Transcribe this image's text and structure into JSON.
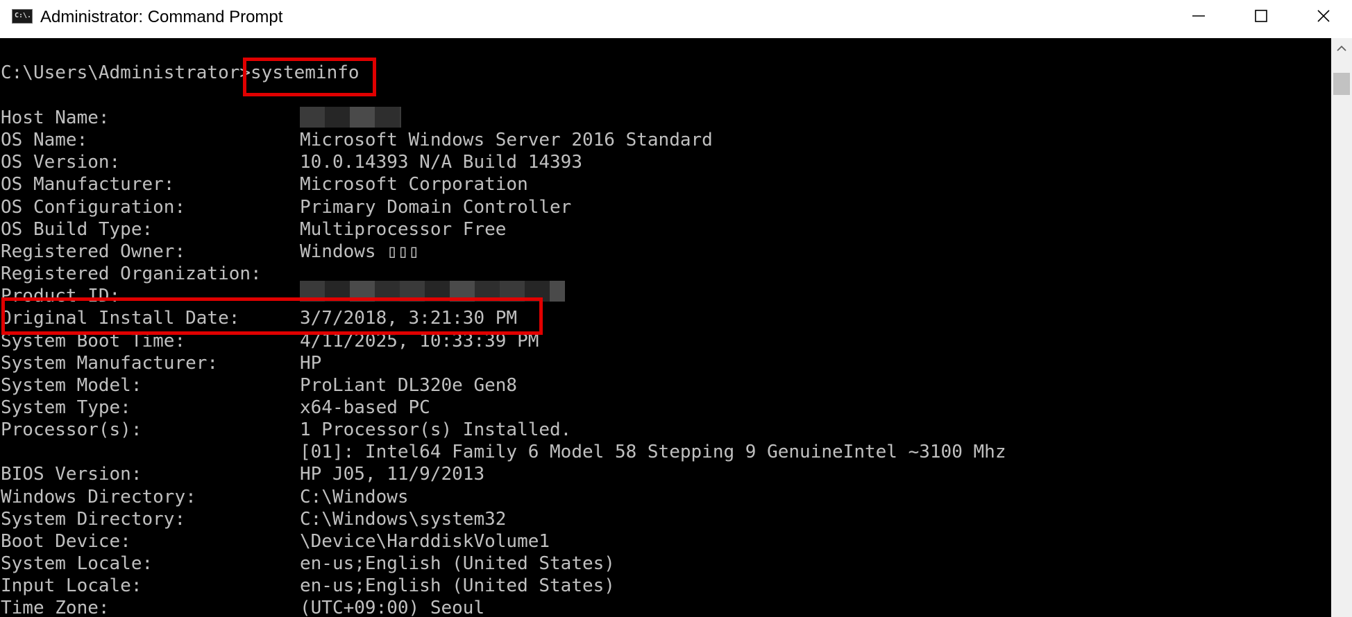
{
  "window": {
    "title": "Administrator: Command Prompt",
    "icon_label": "C:\\.",
    "icon_name": "cmd-console-icon"
  },
  "console": {
    "prompt": "C:\\Users\\Administrator>",
    "command": "systeminfo",
    "rows": [
      {
        "label": "Host Name:",
        "value": ""
      },
      {
        "label": "OS Name:",
        "value": "Microsoft Windows Server 2016 Standard"
      },
      {
        "label": "OS Version:",
        "value": "10.0.14393 N/A Build 14393"
      },
      {
        "label": "OS Manufacturer:",
        "value": "Microsoft Corporation"
      },
      {
        "label": "OS Configuration:",
        "value": "Primary Domain Controller"
      },
      {
        "label": "OS Build Type:",
        "value": "Multiprocessor Free"
      },
      {
        "label": "Registered Owner:",
        "value": "Windows ▯▯▯"
      },
      {
        "label": "Registered Organization:",
        "value": ""
      },
      {
        "label": "Product ID:",
        "value": ""
      },
      {
        "label": "Original Install Date:",
        "value": "3/7/2018, 3:21:30 PM"
      },
      {
        "label": "System Boot Time:",
        "value": "4/11/2025, 10:33:39 PM"
      },
      {
        "label": "System Manufacturer:",
        "value": "HP"
      },
      {
        "label": "System Model:",
        "value": "ProLiant DL320e Gen8"
      },
      {
        "label": "System Type:",
        "value": "x64-based PC"
      },
      {
        "label": "Processor(s):",
        "value": "1 Processor(s) Installed."
      },
      {
        "label": "",
        "value": "[01]: Intel64 Family 6 Model 58 Stepping 9 GenuineIntel ~3100 Mhz"
      },
      {
        "label": "BIOS Version:",
        "value": "HP J05, 11/9/2013"
      },
      {
        "label": "Windows Directory:",
        "value": "C:\\Windows"
      },
      {
        "label": "System Directory:",
        "value": "C:\\Windows\\system32"
      },
      {
        "label": "Boot Device:",
        "value": "\\Device\\HarddiskVolume1"
      },
      {
        "label": "System Locale:",
        "value": "en-us;English (United States)"
      },
      {
        "label": "Input Locale:",
        "value": "en-us;English (United States)"
      },
      {
        "label": "Time Zone:",
        "value": "(UTC+09:00) Seoul"
      }
    ]
  },
  "colors": {
    "console_bg": "#000000",
    "console_fg": "#c0c0c0",
    "highlight": "#e00000"
  }
}
